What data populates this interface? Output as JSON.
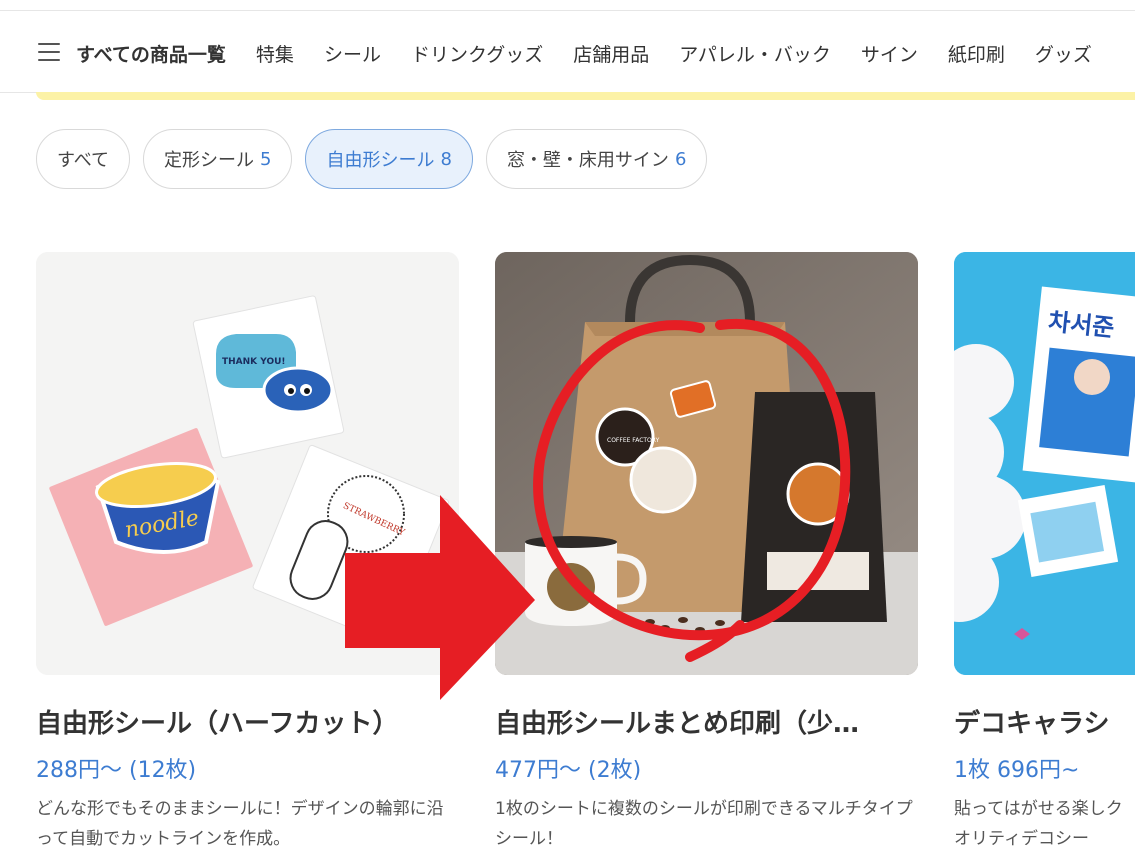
{
  "nav": {
    "menu_label": "すべての商品一覧",
    "items": [
      "特集",
      "シール",
      "ドリンクグッズ",
      "店舗用品",
      "アパレル・バック",
      "サイン",
      "紙印刷",
      "グッズ"
    ]
  },
  "filters": [
    {
      "label": "すべて",
      "count": ""
    },
    {
      "label": "定形シール",
      "count": "5"
    },
    {
      "label": "自由形シール",
      "count": "8"
    },
    {
      "label": "窓・壁・床用サイン",
      "count": "6"
    }
  ],
  "products": [
    {
      "title": "自由形シール（ハーフカット）",
      "price": "288円～ (12枚)",
      "desc": "どんな形でもそのままシールに！デザインの輪郭に沿って自動でカットラインを作成。"
    },
    {
      "title": "自由形シールまとめ印刷（少…",
      "price": "477円～ (2枚)",
      "desc": "1枚のシートに複数のシールが印刷できるマルチタイプシール！"
    },
    {
      "title": "デコキャラシ",
      "price": "1枚 696円~",
      "desc": "貼ってはがせる楽しクオリティデコシー"
    }
  ],
  "images": {
    "sticker_thank_you": "THANK YOU!",
    "sticker_noodle": "noodle",
    "sticker_strawberry": "STRAWBERRY",
    "logo_coffee_factory": "COFFEE FACTORY",
    "card3_sign_text": "차서준"
  },
  "colors": {
    "accent": "#3d7cd1",
    "annotation_red": "#e61e24",
    "highlight_band": "#fcf2a6"
  }
}
